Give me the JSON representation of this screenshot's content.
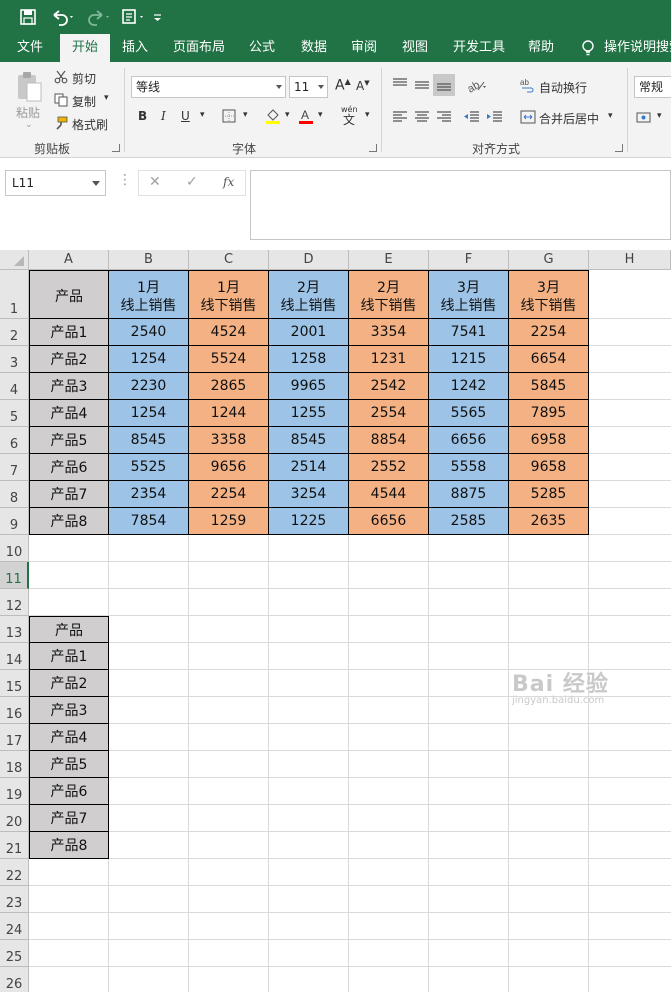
{
  "quick_access": {
    "save_icon": "save-icon",
    "undo_icon": "undo-icon",
    "redo_icon": "redo-icon",
    "preview_icon": "print-preview-icon",
    "customize_icon": "customize-qat-icon"
  },
  "tabs": [
    "文件",
    "开始",
    "插入",
    "页面布局",
    "公式",
    "数据",
    "审阅",
    "视图",
    "开发工具",
    "帮助"
  ],
  "active_tab": "开始",
  "tell_me": "操作说明搜索",
  "ribbon": {
    "clipboard": {
      "paste": "粘贴",
      "cut": "剪切",
      "copy": "复制",
      "format_painter": "格式刷",
      "label": "剪贴板"
    },
    "font": {
      "font_name": "等线",
      "font_size": "11",
      "bold": "B",
      "italic": "I",
      "underline": "U",
      "phonetic": "wén",
      "phonetic_char": "文",
      "label": "字体",
      "fill_color": "#ffff00",
      "font_color": "#ff0000"
    },
    "alignment": {
      "wrap_text": "自动换行",
      "merge_center": "合并后居中",
      "label": "对齐方式"
    },
    "number": {
      "format": "常规"
    }
  },
  "formula_bar": {
    "name_box": "L11",
    "cancel": "✕",
    "enter": "✓",
    "fx": "fx",
    "content": ""
  },
  "sheet": {
    "columns": [
      "A",
      "B",
      "C",
      "D",
      "E",
      "F",
      "G",
      "H"
    ],
    "rows": [
      "1",
      "2",
      "3",
      "4",
      "5",
      "6",
      "7",
      "8",
      "9",
      "10",
      "11",
      "12",
      "13",
      "14",
      "15",
      "16",
      "17",
      "18",
      "19",
      "20",
      "21",
      "22",
      "23",
      "24",
      "25",
      "26"
    ],
    "selected_row": "11",
    "header": {
      "product": "产品",
      "months": [
        {
          "month": "1月",
          "type": "线上销售"
        },
        {
          "month": "1月",
          "type": "线下销售"
        },
        {
          "month": "2月",
          "type": "线上销售"
        },
        {
          "month": "2月",
          "type": "线下销售"
        },
        {
          "month": "3月",
          "type": "线上销售"
        },
        {
          "month": "3月",
          "type": "线下销售"
        }
      ]
    },
    "data": [
      {
        "product": "产品1",
        "values": [
          "2540",
          "4524",
          "2001",
          "3354",
          "7541",
          "2254"
        ]
      },
      {
        "product": "产品2",
        "values": [
          "1254",
          "5524",
          "1258",
          "1231",
          "1215",
          "6654"
        ]
      },
      {
        "product": "产品3",
        "values": [
          "2230",
          "2865",
          "9965",
          "2542",
          "1242",
          "5845"
        ]
      },
      {
        "product": "产品4",
        "values": [
          "1254",
          "1244",
          "1255",
          "2554",
          "5565",
          "7895"
        ]
      },
      {
        "product": "产品5",
        "values": [
          "8545",
          "3358",
          "8545",
          "8854",
          "6656",
          "6958"
        ]
      },
      {
        "product": "产品6",
        "values": [
          "5525",
          "9656",
          "2514",
          "2552",
          "5558",
          "9658"
        ]
      },
      {
        "product": "产品7",
        "values": [
          "2354",
          "2254",
          "3254",
          "4544",
          "8875",
          "5285"
        ]
      },
      {
        "product": "产品8",
        "values": [
          "7854",
          "1259",
          "1225",
          "6656",
          "2585",
          "2635"
        ]
      }
    ],
    "list2_header": "产品",
    "list2": [
      "产品1",
      "产品2",
      "产品3",
      "产品4",
      "产品5",
      "产品6",
      "产品7",
      "产品8"
    ]
  },
  "watermark": {
    "brand": "Bai 经验",
    "url": "jingyan.baidu.com"
  }
}
